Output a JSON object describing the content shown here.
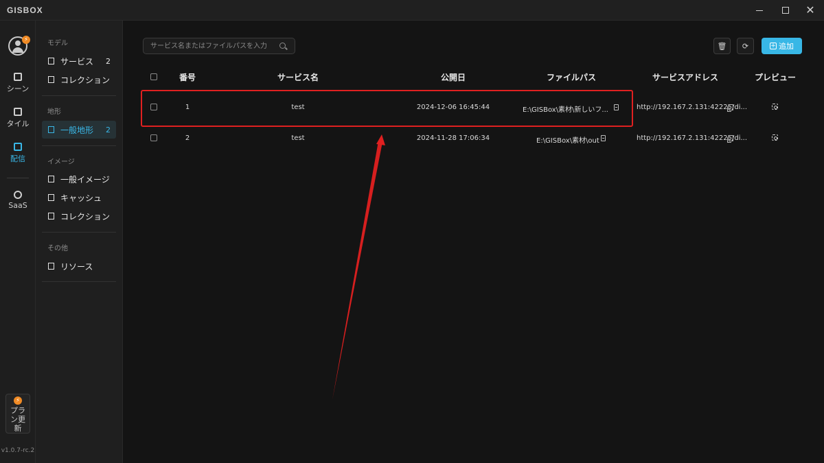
{
  "app": {
    "logo": "GISBOX",
    "version": "v1.0.7-rc.2"
  },
  "window_controls": {
    "minimize": "minimize",
    "maximize": "maximize",
    "close": "✕"
  },
  "rail": {
    "items": [
      {
        "label": "シーン"
      },
      {
        "label": "タイル"
      },
      {
        "label": "配信"
      },
      {
        "label": "SaaS"
      }
    ],
    "plan_update": {
      "line1": "プラ",
      "line2": "ン更",
      "line3": "新"
    }
  },
  "sidebar": {
    "sections": [
      {
        "title": "モデル",
        "items": [
          {
            "label": "サービス",
            "count": "2"
          },
          {
            "label": "コレクション"
          }
        ]
      },
      {
        "title": "地形",
        "items": [
          {
            "label": "一般地形",
            "count": "2"
          }
        ]
      },
      {
        "title": "イメージ",
        "items": [
          {
            "label": "一般イメージ"
          },
          {
            "label": "キャッシュ"
          },
          {
            "label": "コレクション"
          }
        ]
      },
      {
        "title": "その他",
        "items": [
          {
            "label": "リソース"
          }
        ]
      }
    ]
  },
  "toolbar": {
    "search_placeholder": "サービス名またはファイルパスを入力",
    "add_label": "追加"
  },
  "table": {
    "columns": [
      "番号",
      "サービス名",
      "公開日",
      "ファイルパス",
      "サービスアドレス",
      "プレビュー"
    ],
    "rows": [
      {
        "number": "1",
        "name": "test",
        "date": "2024-12-06 16:45:44",
        "path": "E:\\GISBox\\素材\\新しいフ...",
        "address": "http://192.167.2.131:42225/di..."
      },
      {
        "number": "2",
        "name": "test",
        "date": "2024-11-28 17:06:34",
        "path": "E:\\GISBox\\素材\\out",
        "address": "http://192.167.2.131:42225/di..."
      }
    ]
  },
  "colors": {
    "accent": "#38b7e6",
    "annotation": "#e02020",
    "warning": "#f08a24"
  },
  "icons": [
    "user-avatar-icon",
    "bolt-icon",
    "scene-icon",
    "tile-icon",
    "publish-icon",
    "lock-icon",
    "search-icon",
    "delete-icon",
    "refresh-icon",
    "add-icon",
    "document-icon",
    "copy-icon",
    "preview-icon"
  ]
}
